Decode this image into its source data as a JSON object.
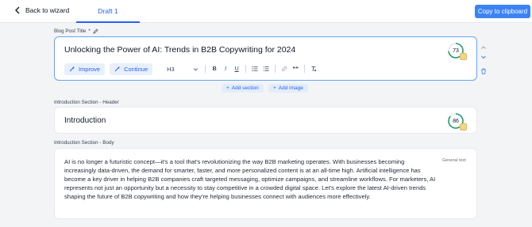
{
  "header": {
    "back_label": "Back to wizard",
    "tab_label": "Draft 1",
    "copy_label": "Copy to clipboard"
  },
  "blog_title": {
    "label": "Blog Post Title",
    "required_mark": "*",
    "value": "Unlocking the Power of AI: Trends in B2B Copywriting for 2024",
    "score": "73",
    "score_fraction": 0.73,
    "toolbar": {
      "improve_label": "Improve",
      "continue_label": "Continue",
      "heading_select": "H3",
      "bold": "B",
      "italic": "I",
      "underline": "U",
      "quote": "❝❝"
    }
  },
  "add_section_label": "Add section",
  "add_image_label": "Add image",
  "intro_header": {
    "label": "Introduction Section - Header",
    "value": "Introduction",
    "score": "86",
    "score_fraction": 0.86
  },
  "intro_body": {
    "label": "Introduction Section - Body",
    "tag": "General text",
    "value": "AI is no longer a futuristic concept—it's a tool that's revolutionizing the way B2B marketing operates. With businesses becoming increasingly data-driven, the demand for smarter, faster, and more personalized content is at an all-time high. Artificial intelligence has become a key driver in helping B2B companies craft targeted messaging, optimize campaigns, and streamline workflows. For marketers, AI represents not just an opportunity but a necessity to stay competitive in a crowded digital space. Let's explore the latest AI-driven trends shaping the future of B2B copywriting and how they're helping businesses connect with audiences more effectively."
  },
  "colors": {
    "accent": "#3b82f6",
    "score_ring": "#22a06b"
  }
}
